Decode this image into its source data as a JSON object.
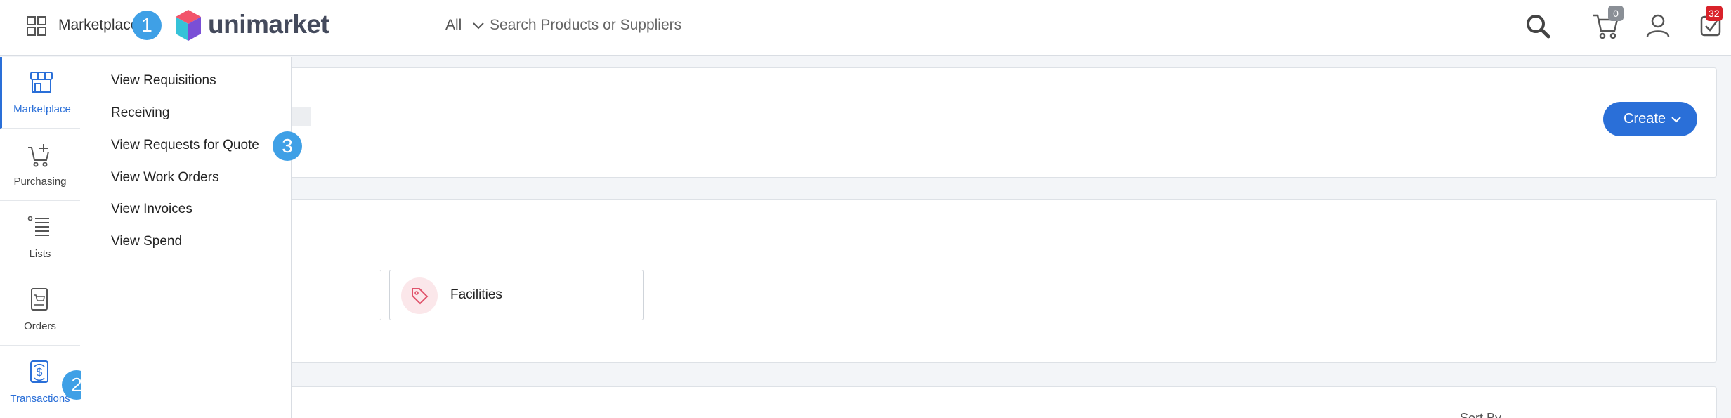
{
  "header": {
    "apps_icon": "grid-icon",
    "marketplace_label": "Marketplace",
    "logo_text": "unimarket",
    "search_scope": "All",
    "search_placeholder": "Search Products or Suppliers",
    "cart_count": "0",
    "tasks_count": "32",
    "badge_colors": {
      "cart": "#8a8f96",
      "tasks": "#d9222a"
    }
  },
  "steps": {
    "one": "1",
    "two": "2",
    "three": "3"
  },
  "sidenav": {
    "items": [
      {
        "label": "Marketplace",
        "icon": "storefront-icon",
        "active": true
      },
      {
        "label": "Purchasing",
        "icon": "cart-plus-icon"
      },
      {
        "label": "Lists",
        "icon": "list-icon"
      },
      {
        "label": "Orders",
        "icon": "receipt-icon"
      },
      {
        "label": "Transactions",
        "icon": "transactions-icon"
      }
    ]
  },
  "menu": {
    "items": [
      "View Requisitions",
      "Receiving",
      "View Requests for Quote",
      "View Work Orders",
      "View Invoices",
      "View Spend"
    ]
  },
  "main": {
    "create_label": "Create",
    "category_tile": "Facilities",
    "sort_label": "Sort By"
  },
  "colors": {
    "accent": "#2a6fd8",
    "step_badge": "#3fa0e6"
  }
}
